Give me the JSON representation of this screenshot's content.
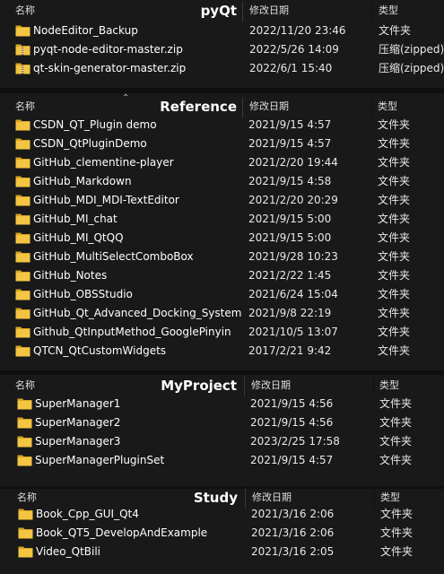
{
  "columns": {
    "name": "名称",
    "date": "修改日期",
    "type": "类型"
  },
  "panels": [
    {
      "title": "pyQt",
      "rows": [
        {
          "name": "NodeEditor_Backup",
          "date": "2022/11/20 23:46",
          "type": "文件夹",
          "icon": "folder-icon"
        },
        {
          "name": "pyqt-node-editor-master.zip",
          "date": "2022/5/26 14:09",
          "type": "压缩(zipped)文件夹",
          "icon": "zip-folder-icon"
        },
        {
          "name": "qt-skin-generator-master.zip",
          "date": "2022/6/1 15:40",
          "type": "压缩(zipped)文件夹",
          "icon": "zip-folder-icon"
        }
      ]
    },
    {
      "title": "Reference",
      "rows": [
        {
          "name": "CSDN_QT_Plugin demo",
          "date": "2021/9/15 4:57",
          "type": "文件夹",
          "icon": "folder-icon"
        },
        {
          "name": "CSDN_QtPluginDemo",
          "date": "2021/9/15 4:57",
          "type": "文件夹",
          "icon": "folder-icon"
        },
        {
          "name": "GitHub_clementine-player",
          "date": "2021/2/20 19:44",
          "type": "文件夹",
          "icon": "folder-icon"
        },
        {
          "name": "GitHub_Markdown",
          "date": "2021/9/15 4:58",
          "type": "文件夹",
          "icon": "folder-icon"
        },
        {
          "name": "GitHub_MDI_MDI-TextEditor",
          "date": "2021/2/20 20:29",
          "type": "文件夹",
          "icon": "folder-icon"
        },
        {
          "name": "GitHub_MI_chat",
          "date": "2021/9/15 5:00",
          "type": "文件夹",
          "icon": "folder-icon"
        },
        {
          "name": "GitHub_MI_QtQQ",
          "date": "2021/9/15 5:00",
          "type": "文件夹",
          "icon": "folder-icon"
        },
        {
          "name": "GitHub_MultiSelectComboBox",
          "date": "2021/9/28 10:23",
          "type": "文件夹",
          "icon": "folder-icon"
        },
        {
          "name": "GitHub_Notes",
          "date": "2021/2/22 1:45",
          "type": "文件夹",
          "icon": "folder-icon"
        },
        {
          "name": "GitHub_OBSStudio",
          "date": "2021/6/24 15:04",
          "type": "文件夹",
          "icon": "folder-icon"
        },
        {
          "name": "GitHub_Qt_Advanced_Docking_System",
          "date": "2021/9/8 22:19",
          "type": "文件夹",
          "icon": "folder-icon"
        },
        {
          "name": "Github_QtInputMethod_GooglePinyin",
          "date": "2021/10/5 13:07",
          "type": "文件夹",
          "icon": "folder-icon"
        },
        {
          "name": "QTCN_QtCustomWidgets",
          "date": "2017/2/21 9:42",
          "type": "文件夹",
          "icon": "folder-icon"
        }
      ]
    },
    {
      "title": "MyProject",
      "rows": [
        {
          "name": "SuperManager1",
          "date": "2021/9/15 4:56",
          "type": "文件夹",
          "icon": "folder-icon"
        },
        {
          "name": "SuperManager2",
          "date": "2021/9/15 4:56",
          "type": "文件夹",
          "icon": "folder-icon"
        },
        {
          "name": "SuperManager3",
          "date": "2023/2/25 17:58",
          "type": "文件夹",
          "icon": "folder-icon"
        },
        {
          "name": "SuperManagerPluginSet",
          "date": "2021/9/15 4:57",
          "type": "文件夹",
          "icon": "folder-icon"
        }
      ]
    },
    {
      "title": "Study",
      "rows": [
        {
          "name": "Book_Cpp_GUI_Qt4",
          "date": "2021/3/16 2:06",
          "type": "文件夹",
          "icon": "folder-icon"
        },
        {
          "name": "Book_QT5_DevelopAndExample",
          "date": "2021/3/16 2:06",
          "type": "文件夹",
          "icon": "folder-icon"
        },
        {
          "name": "Video_QtBili",
          "date": "2021/3/16 2:05",
          "type": "文件夹",
          "icon": "folder-icon"
        }
      ]
    }
  ],
  "colors": {
    "folder": "#f3c542",
    "folder_back": "#d9a622",
    "background": "#191919",
    "separator": "#0f0f0f"
  }
}
